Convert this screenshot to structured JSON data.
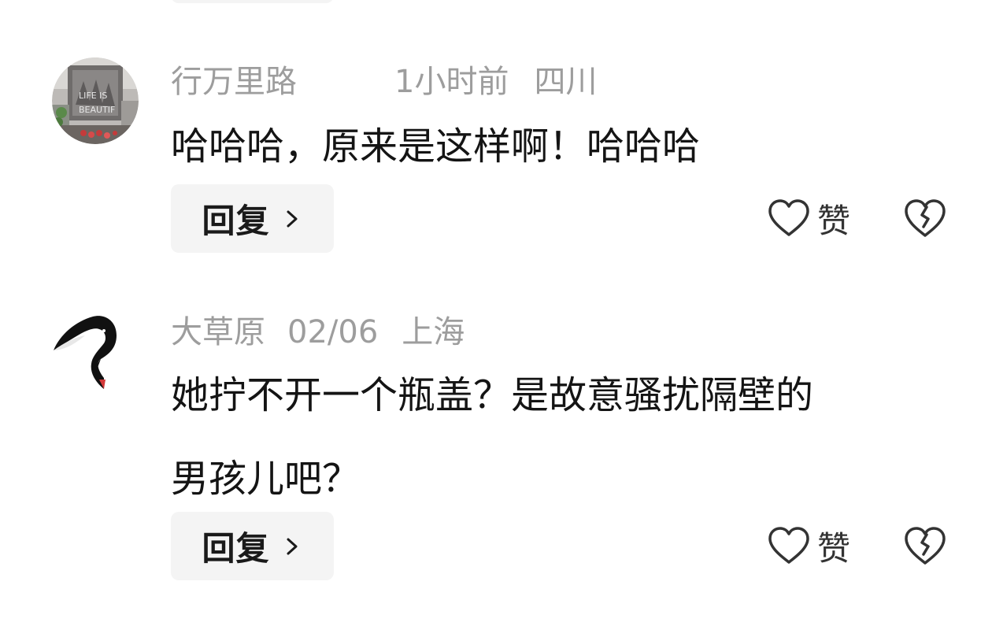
{
  "comments": [
    {
      "username": "行万里路",
      "time": "1小时前",
      "location": "四川",
      "text_lines": [
        "哈哈哈，原来是这样啊！哈哈哈"
      ],
      "reply_label": "回复",
      "like_label": "赞",
      "avatar_icon": "photo-avatar"
    },
    {
      "username": "大草原",
      "time": "02/06",
      "location": "上海",
      "text_lines": [
        "她拧不开一个瓶盖？是故意骚扰隔壁的",
        "男孩儿吧？"
      ],
      "reply_label": "回复",
      "like_label": "赞",
      "avatar_icon": "swan-avatar"
    }
  ],
  "colors": {
    "meta_text": "#9d9d9d",
    "body_text": "#141414",
    "reply_bg": "#f4f4f4",
    "icon_stroke": "#333333"
  }
}
